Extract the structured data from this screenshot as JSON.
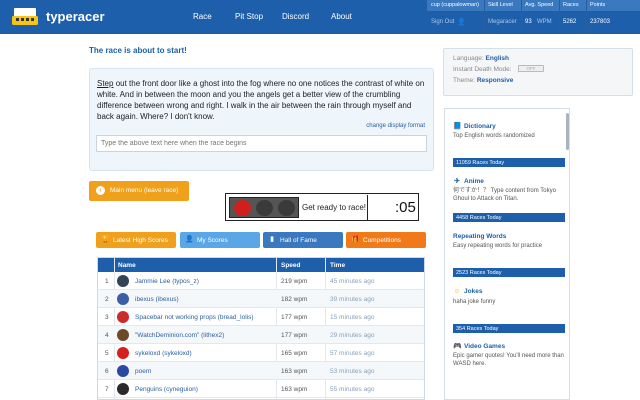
{
  "app": {
    "brand": "typeracer",
    "nav": [
      "Race",
      "Pit Stop",
      "Discord",
      "About"
    ]
  },
  "user_stats": {
    "headers": [
      "cup (cuppalowman)",
      "Skill Level",
      "Avg. Speed",
      "Races",
      "Points"
    ],
    "sign_out": "Sign Out",
    "skill_level": "Megaracer",
    "avg_speed_value": "93",
    "avg_speed_unit": "WPM",
    "races": "5262",
    "points": "237803"
  },
  "race": {
    "status_message": "The race is about to start!",
    "text_first_word": "Step",
    "text_rest": " out the front door like a ghost into the fog where no one notices the contrast of white on white. And in between the moon and you the angels get a better view of the crumbling difference between wrong and right. I walk in the air between the rain through myself and back again. Where? I don't know.",
    "change_display_format": "change display format",
    "input_placeholder": "Type the above text here when the race begins",
    "main_menu_label": "Main menu (leave race)",
    "ready_label": "Get ready to race!",
    "countdown": ":05",
    "lights": [
      "#d11f1f",
      "#3a3a3a",
      "#3a3a3a"
    ]
  },
  "tabs": [
    {
      "label": "Latest High Scores",
      "icon": "trophy-icon",
      "glyph": "🏆",
      "color": "#f0a01a"
    },
    {
      "label": "My Scores",
      "icon": "user-icon",
      "glyph": "👤",
      "color": "#5aa6e6"
    },
    {
      "label": "Hall of Fame",
      "icon": "chart-icon",
      "glyph": "▮",
      "color": "#3a78c0"
    },
    {
      "label": "Competitions",
      "icon": "gift-icon",
      "glyph": "🎁",
      "color": "#f07a1a"
    }
  ],
  "scores_table": {
    "headers": [
      "Name",
      "Speed",
      "Time"
    ],
    "rows": [
      {
        "rank": "1",
        "name": "Jammie Lee (typos_z)",
        "speed": "219 wpm",
        "time": "45 minutes ago",
        "avatar_color": "#334455"
      },
      {
        "rank": "2",
        "name": "ibexus (ibexus)",
        "speed": "182 wpm",
        "time": "39 minutes ago",
        "avatar_color": "#3b5fa6"
      },
      {
        "rank": "3",
        "name": "Spacebar not working props (bread_lolis)",
        "speed": "177 wpm",
        "time": "15 minutes ago",
        "avatar_color": "#cc2b2b"
      },
      {
        "rank": "4",
        "name": "\"WatchDeminion.com\" (lithex2)",
        "speed": "177 wpm",
        "time": "29 minutes ago",
        "avatar_color": "#6b4a2a"
      },
      {
        "rank": "5",
        "name": "sykeloxd (sykeloxd)",
        "speed": "165 wpm",
        "time": "57 minutes ago",
        "avatar_color": "#d62020"
      },
      {
        "rank": "6",
        "name": "poem",
        "speed": "163 wpm",
        "time": "53 minutes ago",
        "avatar_color": "#2a4aa0"
      },
      {
        "rank": "7",
        "name": "Penguins (cyneguion)",
        "speed": "163 wpm",
        "time": "55 minutes ago",
        "avatar_color": "#2a2a2a"
      }
    ]
  },
  "settings": {
    "language_label": "Language:",
    "language_value": "English",
    "instant_death_label": "Instant Death Mode:",
    "instant_death_value": "OFF",
    "theme_label": "Theme:",
    "theme_value": "Responsive"
  },
  "race_categories": [
    {
      "title": "Dictionary",
      "icon": "book-icon",
      "glyph": "📘",
      "desc": "Top English words randomized",
      "races_today": "11059 Races Today"
    },
    {
      "title": "Anime",
      "icon": "anime-icon",
      "glyph": "✈",
      "desc": "何ですか！？ Type content from Tokyo Ghoul to Attack on Titan.",
      "races_today": "4458 Races Today"
    },
    {
      "title": "Repeating Words",
      "icon": "repeat-icon",
      "glyph": "",
      "desc": "Easy repeating words for practice",
      "races_today": "2523 Races Today"
    },
    {
      "title": "Jokes",
      "icon": "smile-icon",
      "glyph": "☺",
      "desc": "haha joke funny",
      "races_today": "354 Races Today"
    },
    {
      "title": "Video Games",
      "icon": "gamepad-icon",
      "glyph": "🎮",
      "desc": "Epic gamer quotes! You'll need more than WASD here.",
      "races_today": ""
    }
  ]
}
